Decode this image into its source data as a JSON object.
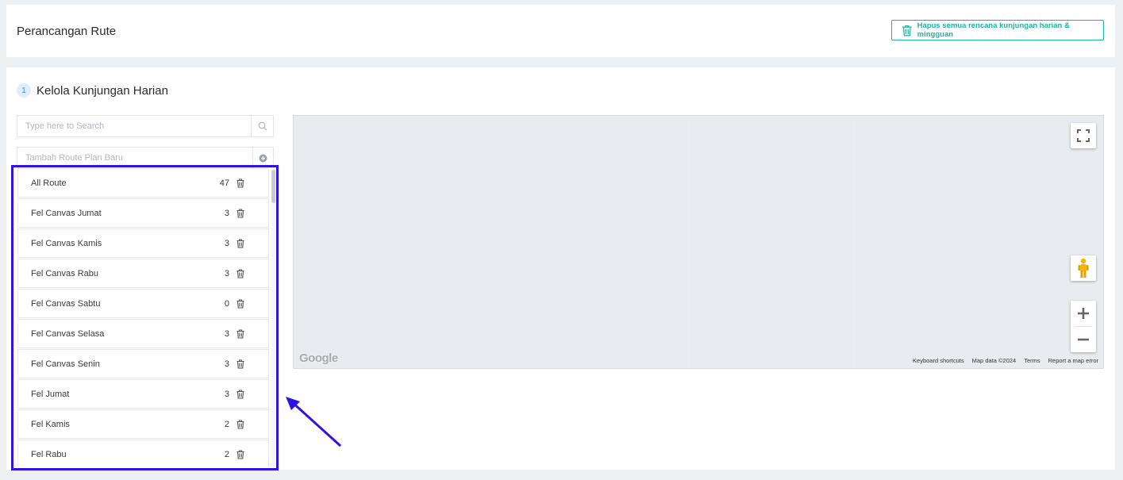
{
  "header": {
    "title": "Perancangan Rute",
    "clear_button": "Hapus semua rencana kunjungan harian & mingguan"
  },
  "section": {
    "step": "1",
    "title": "Kelola Kunjungan Harian"
  },
  "search": {
    "placeholder": "Type here to Search"
  },
  "add_route": {
    "placeholder": "Tambah Route Plan Baru"
  },
  "routes": [
    {
      "name": "All Route",
      "count": "47"
    },
    {
      "name": "Fel Canvas Jumat",
      "count": "3"
    },
    {
      "name": "Fel Canvas Kamis",
      "count": "3"
    },
    {
      "name": "Fel Canvas Rabu",
      "count": "3"
    },
    {
      "name": "Fel Canvas Sabtu",
      "count": "0"
    },
    {
      "name": "Fel Canvas Selasa",
      "count": "3"
    },
    {
      "name": "Fel Canvas Senin",
      "count": "3"
    },
    {
      "name": "Fel Jumat",
      "count": "3"
    },
    {
      "name": "Fel Kamis",
      "count": "2"
    },
    {
      "name": "Fel Rabu",
      "count": "2"
    }
  ],
  "map": {
    "logo": "Google",
    "footer": {
      "shortcuts": "Keyboard shortcuts",
      "data": "Map data ©2024",
      "terms": "Terms",
      "report": "Report a map error"
    }
  },
  "colors": {
    "accent": "#1bb7a6",
    "highlight": "#2f12e6",
    "background": "#eef1f4"
  }
}
